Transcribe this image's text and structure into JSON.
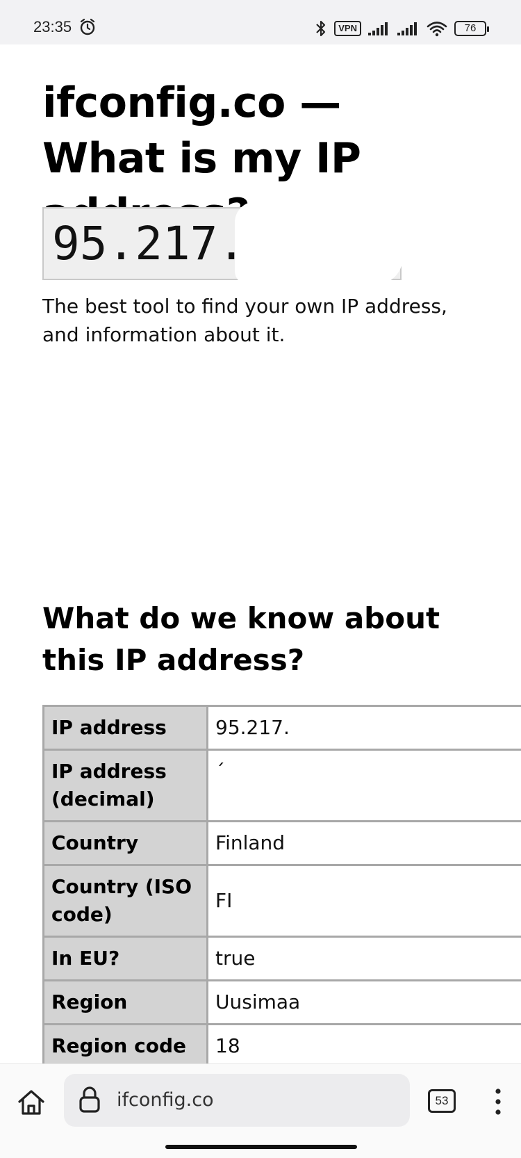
{
  "status_bar": {
    "time": "23:35",
    "vpn_label": "VPN",
    "battery": "76",
    "icons": [
      "alarm-icon",
      "bluetooth-icon",
      "vpn-icon",
      "signal-icon",
      "signal-icon",
      "wifi-icon",
      "battery-icon"
    ]
  },
  "page": {
    "title": "ifconfig.co — What is my IP address?",
    "ip_display": "95.217.",
    "tagline": "The best tool to find your own IP address, and information about it.",
    "section_title": "What do we know about this IP address?",
    "table": [
      {
        "key": "IP address",
        "value": "95.217."
      },
      {
        "key": "IP address (decimal)",
        "value": "´"
      },
      {
        "key": "Country",
        "value": "Finland"
      },
      {
        "key": "Country (ISO code)",
        "value": "FI"
      },
      {
        "key": "In EU?",
        "value": "true"
      },
      {
        "key": "Region",
        "value": "Uusimaa"
      },
      {
        "key": "Region code",
        "value": "18"
      }
    ]
  },
  "browser": {
    "url": "ifconfig.co",
    "tab_count": "53",
    "icons": [
      "home-icon",
      "lock-icon",
      "tabs-icon",
      "more-vertical-icon"
    ]
  }
}
